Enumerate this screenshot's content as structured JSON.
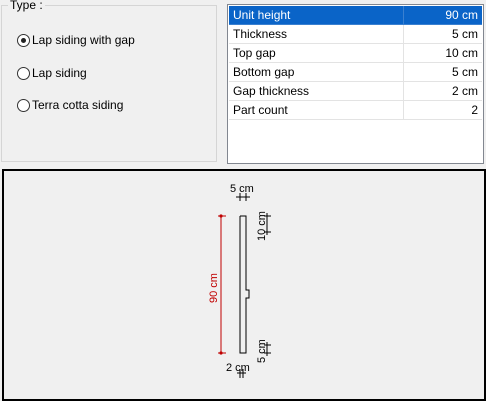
{
  "type_group": {
    "legend": "Type :",
    "options": [
      {
        "label": "Lap siding with gap",
        "checked": true
      },
      {
        "label": "Lap siding",
        "checked": false
      },
      {
        "label": "Terra cotta siding",
        "checked": false
      }
    ]
  },
  "properties": [
    {
      "name": "Unit height",
      "value": "90 cm"
    },
    {
      "name": "Thickness",
      "value": "5 cm"
    },
    {
      "name": "Top gap",
      "value": "10 cm"
    },
    {
      "name": "Bottom gap",
      "value": "5 cm"
    },
    {
      "name": "Gap thickness",
      "value": "2 cm"
    },
    {
      "name": "Part count",
      "value": "2"
    }
  ],
  "preview": {
    "thickness_label": "5 cm",
    "top_gap_label": "10 cm",
    "height_label": "90 cm",
    "bottom_gap_label": "5 cm",
    "gap_thickness_label": "2 cm",
    "dimension_color": "#c00000"
  }
}
